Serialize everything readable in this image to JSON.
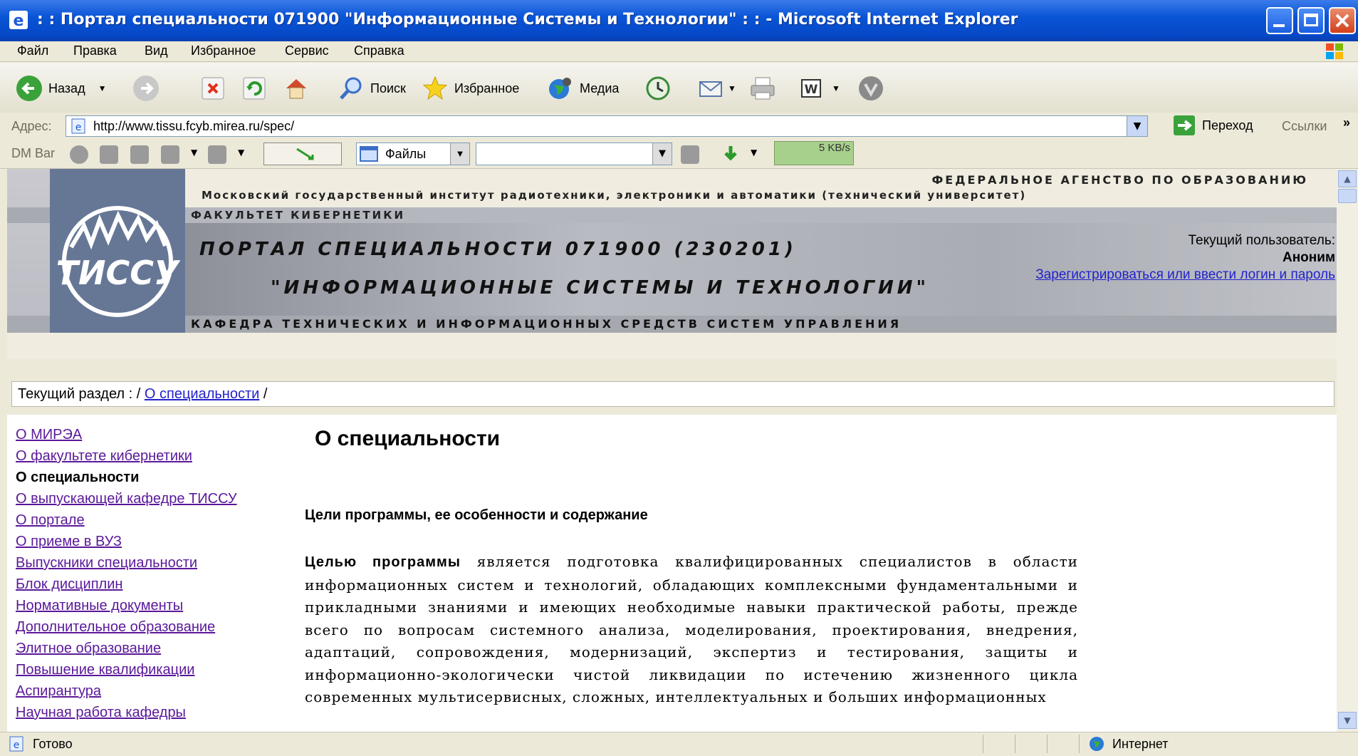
{
  "window": {
    "title": ": : Портал специальности 071900 \"Информационные Системы и Технологии\" : : - Microsoft Internet Explorer"
  },
  "menu": [
    "Файл",
    "Правка",
    "Вид",
    "Избранное",
    "Сервис",
    "Справка"
  ],
  "toolbar": {
    "back": "Назад",
    "search": "Поиск",
    "favorites": "Избранное",
    "media": "Медиа"
  },
  "address": {
    "label": "Адрес:",
    "url": "http://www.tissu.fcyb.mirea.ru/spec/",
    "go": "Переход",
    "links": "Ссылки"
  },
  "dmbar": {
    "label": "DM Bar",
    "files": "Файлы",
    "speed": "5 KB/s"
  },
  "header": {
    "agency": "ФЕДЕРАЛЬНОЕ АГЕНСТВО ПО ОБРАЗОВАНИЮ",
    "institute": "Московский государственный институт радиотехники, электроники и автоматики (технический университет)",
    "faculty": "ФАКУЛЬТЕТ КИБЕРНЕТИКИ",
    "portal_line1": "ПОРТАЛ СПЕЦИАЛЬНОСТИ 071900 (230201)",
    "portal_line2": "\"ИНФОРМАЦИОННЫЕ СИСТЕМЫ И ТЕХНОЛОГИИ\"",
    "department": "КАФЕДРА ТЕХНИЧЕСКИХ И ИНФОРМАЦИОННЫХ СРЕДСТВ СИСТЕМ УПРАВЛЕНИЯ",
    "logo_text": "ТИССУ",
    "current_user_label": "Текущий пользователь:",
    "current_user": "Аноним",
    "register_link": "Зарегистрироваться или ввести логин и пароль"
  },
  "breadcrumb": {
    "prefix": "Текущий раздел : /",
    "link": "О специальности",
    "suffix": "/"
  },
  "nav": [
    {
      "label": "О МИРЭА",
      "current": false
    },
    {
      "label": "О факультете кибернетики",
      "current": false
    },
    {
      "label": "О специальности",
      "current": true
    },
    {
      "label": "О выпускающей кафедре ТИССУ",
      "current": false
    },
    {
      "label": "О портале",
      "current": false
    },
    {
      "label": "О приеме в ВУЗ",
      "current": false
    },
    {
      "label": "Выпускники специальности",
      "current": false
    },
    {
      "label": "Блок дисциплин",
      "current": false
    },
    {
      "label": "Нормативные документы",
      "current": false
    },
    {
      "label": "Дополнительное образование",
      "current": false
    },
    {
      "label": "Элитное образование",
      "current": false
    },
    {
      "label": "Повышение квалификации",
      "current": false
    },
    {
      "label": "Аспирантура",
      "current": false
    },
    {
      "label": "Научная работа кафедры",
      "current": false
    }
  ],
  "content": {
    "heading": "О специальности",
    "subheading": "Цели программы, ее особенности и содержание",
    "para_lead": "Целью программы",
    "para_text": " является подготовка квалифицированных специалистов в области информационных систем и технологий, обладающих комплексными фундаментальными и прикладными знаниями и имеющих необходимые навыки практической работы, прежде всего по вопросам системного анализа, моделирования, проектирования, внедрения, адаптаций, сопровождения, модернизаций, экспертиз и тестирования, защиты и информационно-экологически чистой ликвидации по истечению жизненного цикла современных мультисервисных, сложных, интеллектуальных и больших информационных"
  },
  "status": {
    "text": "Готово",
    "zone": "Интернет"
  }
}
